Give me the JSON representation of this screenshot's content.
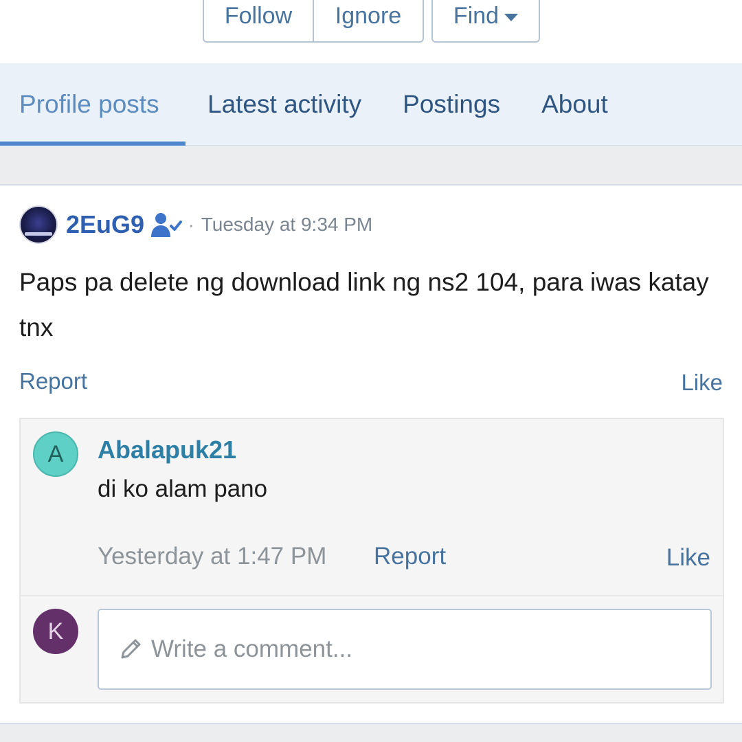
{
  "actions": {
    "follow_label": "Follow",
    "ignore_label": "Ignore",
    "find_label": "Find"
  },
  "tabs": [
    {
      "label": "Profile posts",
      "active": true
    },
    {
      "label": "Latest activity",
      "active": false
    },
    {
      "label": "Postings",
      "active": false
    },
    {
      "label": "About",
      "active": false
    }
  ],
  "post": {
    "username": "2EuG9",
    "separator": "·",
    "timestamp": "Tuesday at 9:34 PM",
    "body": "Paps pa delete ng download link ng ns2 104, para iwas katay tnx",
    "report_label": "Report",
    "like_label": "Like"
  },
  "comment": {
    "avatar_letter": "A",
    "username": "Abalapuk21",
    "text": "di ko alam pano",
    "timestamp": "Yesterday at 1:47 PM",
    "report_label": "Report",
    "like_label": "Like"
  },
  "reply_box": {
    "avatar_letter": "K",
    "placeholder": "Write a comment..."
  },
  "colors": {
    "link": "#47739f",
    "username": "#2e5fb0",
    "tab_active_underline": "#4f86d0",
    "avatar_a": "#5fd0c6",
    "avatar_k": "#64306a"
  },
  "icons": {
    "user_status": "user-check-icon",
    "caret": "caret-down-icon",
    "compose": "pencil-icon"
  }
}
